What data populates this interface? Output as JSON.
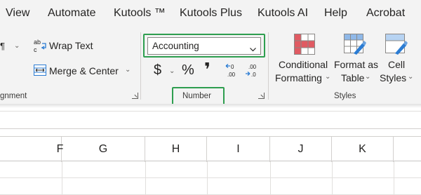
{
  "menu": {
    "items": [
      "View",
      "Automate",
      "Kutools ™",
      "Kutools Plus",
      "Kutools AI",
      "Help",
      "Acrobat"
    ]
  },
  "alignment": {
    "wrap_text_label": "Wrap Text",
    "merge_center_label": "Merge & Center",
    "group_label_partial": "gnment"
  },
  "number": {
    "format_value": "Accounting",
    "currency_symbol": "$",
    "percent_symbol": "%",
    "comma_symbol": "❜",
    "group_label": "Number"
  },
  "styles": {
    "conditional_formatting_line1": "Conditional",
    "conditional_formatting_line2": "Formatting",
    "format_as_table_line1": "Format as",
    "format_as_table_line2": "Table",
    "cell_styles_line1": "Cell",
    "cell_styles_line2": "Styles",
    "group_label": "Styles"
  },
  "columns": [
    "F",
    "G",
    "H",
    "I",
    "J",
    "K"
  ],
  "colors": {
    "highlight": "#2e9e4f",
    "ribbon_bg": "#f3f3f3",
    "cf_red": "#e05a62",
    "table_blue": "#2b7cd3"
  }
}
